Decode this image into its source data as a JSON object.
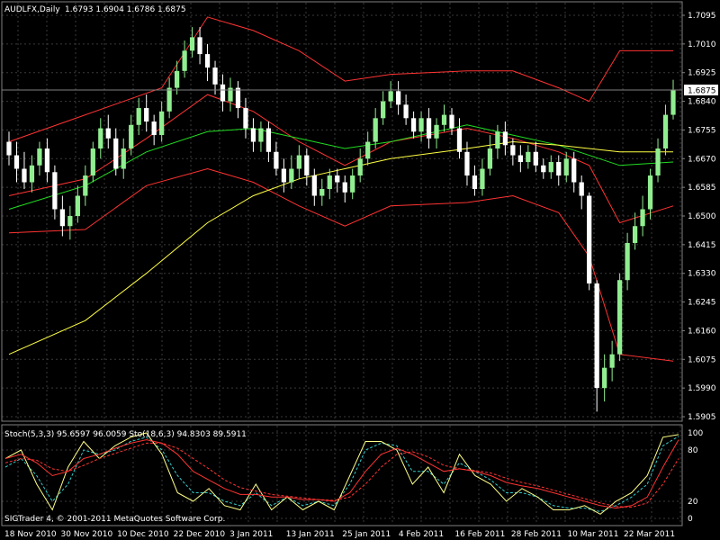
{
  "header": {
    "symbol": "AUDLFX,Daily",
    "ohlc": "1.6793 1.6904 1.6786 1.6875"
  },
  "stoch_header": "Stoch(5,3,3) 95.6597 96.0059  Sto(18,6,3) 94.8303 89.5911",
  "copyright": "SIGTrader 4, © 2001-2011 MetaQuotes Software Corp.",
  "colors": {
    "background": "#000000",
    "grid": "#3a3a3a",
    "bull_candle": "#90ee90",
    "bear_candle": "#ffffff",
    "bollinger": "#ff3333",
    "ma_medium": "#22dd22",
    "ma_long": "#ffff44",
    "stoch_fast_main": "#ffff88",
    "stoch_fast_signal": "#33cccc",
    "stoch_slow_main": "#ff3333",
    "stoch_slow_signal": "#ff3333",
    "text": "#ffffff"
  },
  "chart_data": {
    "type": "candlestick",
    "dates": [
      "18 Nov 2010",
      "30 Nov 2010",
      "10 Dec 2010",
      "22 Dec 2010",
      "3 Jan 2011",
      "13 Jan 2011",
      "25 Jan 2011",
      "4 Feb 2011",
      "16 Feb 2011",
      "28 Feb 2011",
      "10 Mar 2011",
      "22 Mar 2011"
    ],
    "price_ticks": [
      "1.7095",
      "1.7010",
      "1.6925",
      "1.6840",
      "1.6755",
      "1.6670",
      "1.6585",
      "1.6500",
      "1.6415",
      "1.6330",
      "1.6245",
      "1.6160",
      "1.6075",
      "1.5990",
      "1.5905"
    ],
    "current_price": "1.6875",
    "ylim": [
      1.5905,
      1.7095
    ],
    "candles": [
      [
        1.672,
        1.668,
        1.675,
        1.665
      ],
      [
        1.668,
        1.664,
        1.672,
        1.66
      ],
      [
        1.664,
        1.66,
        1.669,
        1.658
      ],
      [
        1.66,
        1.665,
        1.668,
        1.657
      ],
      [
        1.665,
        1.67,
        1.672,
        1.662
      ],
      [
        1.67,
        1.663,
        1.673,
        1.66
      ],
      [
        1.663,
        1.652,
        1.665,
        1.649
      ],
      [
        1.652,
        1.647,
        1.656,
        1.644
      ],
      [
        1.647,
        1.65,
        1.653,
        1.643
      ],
      [
        1.65,
        1.656,
        1.659,
        1.648
      ],
      [
        1.656,
        1.662,
        1.665,
        1.653
      ],
      [
        1.662,
        1.67,
        1.672,
        1.66
      ],
      [
        1.67,
        1.676,
        1.679,
        1.667
      ],
      [
        1.676,
        1.673,
        1.68,
        1.67
      ],
      [
        1.673,
        1.664,
        1.676,
        1.662
      ],
      [
        1.664,
        1.67,
        1.673,
        1.661
      ],
      [
        1.67,
        1.677,
        1.68,
        1.668
      ],
      [
        1.677,
        1.682,
        1.685,
        1.674
      ],
      [
        1.682,
        1.678,
        1.686,
        1.675
      ],
      [
        1.678,
        1.674,
        1.68,
        1.671
      ],
      [
        1.674,
        1.681,
        1.684,
        1.672
      ],
      [
        1.681,
        1.688,
        1.691,
        1.679
      ],
      [
        1.688,
        1.693,
        1.696,
        1.686
      ],
      [
        1.693,
        1.699,
        1.702,
        1.691
      ],
      [
        1.699,
        1.703,
        1.706,
        1.697
      ],
      [
        1.703,
        1.698,
        1.706,
        1.695
      ],
      [
        1.698,
        1.694,
        1.701,
        1.69
      ],
      [
        1.694,
        1.689,
        1.696,
        1.686
      ],
      [
        1.689,
        1.684,
        1.692,
        1.681
      ],
      [
        1.684,
        1.688,
        1.691,
        1.681
      ],
      [
        1.688,
        1.682,
        1.69,
        1.679
      ],
      [
        1.682,
        1.676,
        1.685,
        1.673
      ],
      [
        1.676,
        1.672,
        1.679,
        1.669
      ],
      [
        1.672,
        1.676,
        1.678,
        1.669
      ],
      [
        1.676,
        1.669,
        1.678,
        1.666
      ],
      [
        1.669,
        1.664,
        1.672,
        1.662
      ],
      [
        1.664,
        1.66,
        1.667,
        1.657
      ],
      [
        1.66,
        1.664,
        1.668,
        1.658
      ],
      [
        1.664,
        1.668,
        1.671,
        1.661
      ],
      [
        1.668,
        1.662,
        1.67,
        1.659
      ],
      [
        1.662,
        1.656,
        1.664,
        1.653
      ],
      [
        1.656,
        1.658,
        1.661,
        1.653
      ],
      [
        1.658,
        1.662,
        1.664,
        1.655
      ],
      [
        1.662,
        1.66,
        1.664,
        1.657
      ],
      [
        1.66,
        1.657,
        1.662,
        1.654
      ],
      [
        1.657,
        1.662,
        1.664,
        1.655
      ],
      [
        1.662,
        1.667,
        1.67,
        1.66
      ],
      [
        1.667,
        1.672,
        1.675,
        1.665
      ],
      [
        1.672,
        1.679,
        1.682,
        1.67
      ],
      [
        1.679,
        1.684,
        1.687,
        1.677
      ],
      [
        1.684,
        1.687,
        1.69,
        1.682
      ],
      [
        1.687,
        1.683,
        1.69,
        1.68
      ],
      [
        1.683,
        1.679,
        1.686,
        1.677
      ],
      [
        1.679,
        1.675,
        1.681,
        1.673
      ],
      [
        1.675,
        1.679,
        1.681,
        1.672
      ],
      [
        1.679,
        1.673,
        1.682,
        1.67
      ],
      [
        1.673,
        1.677,
        1.679,
        1.67
      ],
      [
        1.677,
        1.68,
        1.683,
        1.675
      ],
      [
        1.68,
        1.676,
        1.682,
        1.674
      ],
      [
        1.676,
        1.669,
        1.679,
        1.667
      ],
      [
        1.669,
        1.662,
        1.672,
        1.659
      ],
      [
        1.662,
        1.658,
        1.665,
        1.656
      ],
      [
        1.658,
        1.664,
        1.667,
        1.656
      ],
      [
        1.664,
        1.67,
        1.674,
        1.662
      ],
      [
        1.67,
        1.675,
        1.677,
        1.667
      ],
      [
        1.675,
        1.671,
        1.678,
        1.668
      ],
      [
        1.671,
        1.668,
        1.673,
        1.665
      ],
      [
        1.668,
        1.666,
        1.671,
        1.663
      ],
      [
        1.666,
        1.669,
        1.671,
        1.664
      ],
      [
        1.669,
        1.665,
        1.672,
        1.663
      ],
      [
        1.665,
        1.663,
        1.667,
        1.661
      ],
      [
        1.663,
        1.666,
        1.668,
        1.661
      ],
      [
        1.666,
        1.662,
        1.668,
        1.659
      ],
      [
        1.662,
        1.667,
        1.669,
        1.66
      ],
      [
        1.667,
        1.66,
        1.669,
        1.657
      ],
      [
        1.66,
        1.656,
        1.662,
        1.652
      ],
      [
        1.656,
        1.63,
        1.657,
        1.628
      ],
      [
        1.63,
        1.599,
        1.631,
        1.592
      ],
      [
        1.599,
        1.605,
        1.609,
        1.595
      ],
      [
        1.605,
        1.609,
        1.613,
        1.601
      ],
      [
        1.609,
        1.631,
        1.633,
        1.607
      ],
      [
        1.631,
        1.642,
        1.645,
        1.628
      ],
      [
        1.642,
        1.647,
        1.651,
        1.64
      ],
      [
        1.647,
        1.652,
        1.656,
        1.644
      ],
      [
        1.652,
        1.662,
        1.664,
        1.649
      ],
      [
        1.662,
        1.67,
        1.673,
        1.66
      ],
      [
        1.67,
        1.68,
        1.683,
        1.668
      ],
      [
        1.68,
        1.6875,
        1.6904,
        1.6786
      ]
    ],
    "bollinger_upper": [
      [
        0,
        1.672
      ],
      [
        10,
        1.68
      ],
      [
        20,
        1.688
      ],
      [
        26,
        1.709
      ],
      [
        32,
        1.705
      ],
      [
        38,
        1.699
      ],
      [
        44,
        1.69
      ],
      [
        50,
        1.692
      ],
      [
        60,
        1.693
      ],
      [
        66,
        1.693
      ],
      [
        72,
        1.688
      ],
      [
        76,
        1.684
      ],
      [
        80,
        1.699
      ],
      [
        87,
        1.699
      ]
    ],
    "bollinger_middle": [
      [
        0,
        1.656
      ],
      [
        10,
        1.661
      ],
      [
        18,
        1.673
      ],
      [
        26,
        1.686
      ],
      [
        32,
        1.681
      ],
      [
        38,
        1.672
      ],
      [
        44,
        1.665
      ],
      [
        50,
        1.672
      ],
      [
        60,
        1.676
      ],
      [
        66,
        1.673
      ],
      [
        72,
        1.669
      ],
      [
        76,
        1.665
      ],
      [
        80,
        1.648
      ],
      [
        87,
        1.653
      ]
    ],
    "bollinger_lower": [
      [
        0,
        1.645
      ],
      [
        10,
        1.646
      ],
      [
        18,
        1.659
      ],
      [
        26,
        1.664
      ],
      [
        32,
        1.66
      ],
      [
        38,
        1.653
      ],
      [
        44,
        1.647
      ],
      [
        50,
        1.653
      ],
      [
        60,
        1.654
      ],
      [
        66,
        1.656
      ],
      [
        72,
        1.651
      ],
      [
        76,
        1.638
      ],
      [
        80,
        1.609
      ],
      [
        87,
        1.607
      ]
    ],
    "ma_medium": [
      [
        0,
        1.652
      ],
      [
        10,
        1.659
      ],
      [
        18,
        1.669
      ],
      [
        26,
        1.675
      ],
      [
        32,
        1.676
      ],
      [
        38,
        1.673
      ],
      [
        44,
        1.67
      ],
      [
        50,
        1.672
      ],
      [
        60,
        1.677
      ],
      [
        66,
        1.674
      ],
      [
        72,
        1.671
      ],
      [
        80,
        1.665
      ],
      [
        87,
        1.666
      ]
    ],
    "ma_long": [
      [
        0,
        1.609
      ],
      [
        10,
        1.619
      ],
      [
        18,
        1.633
      ],
      [
        26,
        1.648
      ],
      [
        32,
        1.656
      ],
      [
        38,
        1.661
      ],
      [
        44,
        1.664
      ],
      [
        50,
        1.667
      ],
      [
        60,
        1.67
      ],
      [
        66,
        1.672
      ],
      [
        72,
        1.671
      ],
      [
        80,
        1.669
      ],
      [
        87,
        1.669
      ]
    ],
    "stoch_ticks": [
      "100",
      "80",
      "20",
      "0"
    ],
    "stoch_ylim": [
      0,
      100
    ],
    "stoch_fast_main": [
      70,
      80,
      40,
      10,
      60,
      90,
      70,
      85,
      95,
      100,
      75,
      30,
      20,
      35,
      15,
      10,
      40,
      10,
      25,
      10,
      20,
      10,
      50,
      90,
      90,
      80,
      40,
      60,
      30,
      75,
      50,
      40,
      20,
      35,
      25,
      10,
      10,
      15,
      5,
      20,
      30,
      50,
      95,
      98
    ],
    "stoch_fast_signal": [
      60,
      70,
      50,
      20,
      40,
      80,
      75,
      80,
      90,
      95,
      80,
      50,
      30,
      30,
      20,
      15,
      30,
      15,
      25,
      15,
      20,
      15,
      40,
      80,
      88,
      85,
      55,
      55,
      40,
      65,
      55,
      45,
      30,
      30,
      25,
      15,
      12,
      12,
      8,
      15,
      25,
      40,
      85,
      96
    ],
    "stoch_slow_main": [
      70,
      75,
      65,
      50,
      55,
      70,
      75,
      82,
      88,
      92,
      88,
      75,
      55,
      45,
      35,
      28,
      28,
      25,
      25,
      22,
      22,
      20,
      30,
      55,
      75,
      82,
      75,
      65,
      55,
      58,
      55,
      50,
      42,
      38,
      35,
      30,
      25,
      20,
      15,
      12,
      15,
      25,
      60,
      92
    ],
    "stoch_slow_signal": [
      65,
      70,
      68,
      58,
      55,
      62,
      70,
      76,
      82,
      88,
      88,
      82,
      70,
      58,
      45,
      36,
      32,
      28,
      26,
      24,
      22,
      21,
      25,
      40,
      60,
      75,
      78,
      72,
      62,
      58,
      56,
      53,
      47,
      42,
      38,
      33,
      28,
      23,
      18,
      14,
      13,
      18,
      40,
      70
    ]
  }
}
